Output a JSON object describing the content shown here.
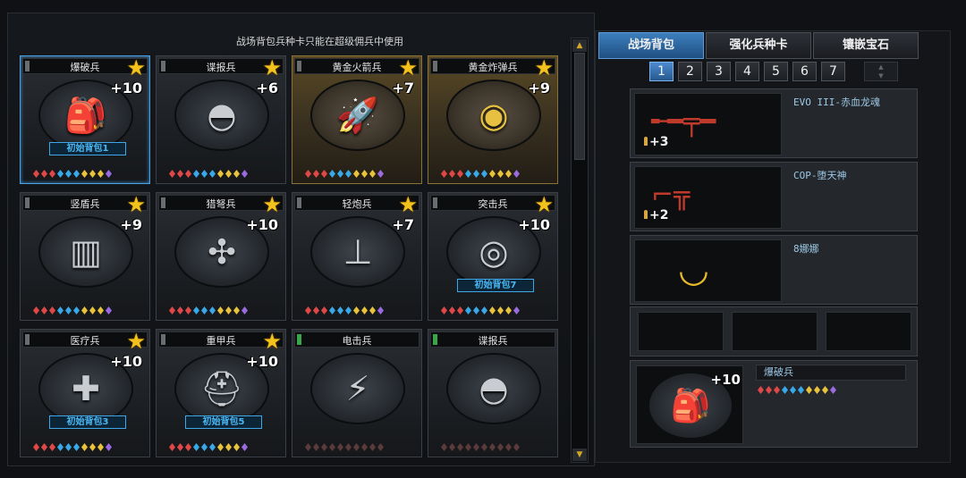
{
  "notice": "战场背包兵种卡只能在超级佣兵中使用",
  "cards": [
    {
      "title": "爆破兵",
      "level": "+10",
      "pack": "初始背包1",
      "icon": "demolition-pack-icon",
      "glyph": "🎒",
      "gold": false,
      "selected": true,
      "star": true,
      "tag": "gray"
    },
    {
      "title": "谍报兵",
      "level": "+6",
      "pack": "",
      "icon": "spy-mask-icon",
      "glyph": "◓",
      "gold": false,
      "selected": false,
      "star": true,
      "tag": "gray"
    },
    {
      "title": "黄金火箭兵",
      "level": "+7",
      "pack": "",
      "icon": "rocket-launcher-icon",
      "glyph": "🚀",
      "gold": true,
      "selected": false,
      "star": true,
      "tag": "gray"
    },
    {
      "title": "黄金炸弹兵",
      "level": "+9",
      "pack": "",
      "icon": "gold-bomb-icon",
      "glyph": "◉",
      "gold": true,
      "selected": false,
      "star": true,
      "tag": "gray"
    },
    {
      "title": "竖盾兵",
      "level": "+9",
      "pack": "",
      "icon": "tower-shield-icon",
      "glyph": "▥",
      "gold": false,
      "selected": false,
      "star": true,
      "tag": "gray"
    },
    {
      "title": "猎弩兵",
      "level": "+10",
      "pack": "",
      "icon": "crossbow-icon",
      "glyph": "✣",
      "gold": false,
      "selected": false,
      "star": true,
      "tag": "gray"
    },
    {
      "title": "轻炮兵",
      "level": "+7",
      "pack": "",
      "icon": "mortar-icon",
      "glyph": "⊥",
      "gold": false,
      "selected": false,
      "star": true,
      "tag": "gray"
    },
    {
      "title": "突击兵",
      "level": "+10",
      "pack": "初始背包7",
      "icon": "assault-scope-icon",
      "glyph": "◎",
      "gold": false,
      "selected": false,
      "star": true,
      "tag": "gray"
    },
    {
      "title": "医疗兵",
      "level": "+10",
      "pack": "初始背包3",
      "icon": "medkit-icon",
      "glyph": "✚",
      "gold": false,
      "selected": false,
      "star": true,
      "tag": "gray"
    },
    {
      "title": "重甲兵",
      "level": "+10",
      "pack": "初始背包5",
      "icon": "heavy-helmet-icon",
      "glyph": "⛑",
      "gold": false,
      "selected": false,
      "star": true,
      "tag": "gray"
    },
    {
      "title": "电击兵",
      "level": "",
      "pack": "",
      "icon": "electric-gauntlet-icon",
      "glyph": "⚡",
      "gold": false,
      "selected": false,
      "star": false,
      "tag": "green"
    },
    {
      "title": "谍报兵",
      "level": "",
      "pack": "",
      "icon": "spy-mask-icon",
      "glyph": "◓",
      "gold": false,
      "selected": false,
      "star": false,
      "tag": "green"
    }
  ],
  "tabs": [
    "战场背包",
    "强化兵种卡",
    "镶嵌宝石"
  ],
  "pages": [
    "1",
    "2",
    "3",
    "4",
    "5",
    "6",
    "7"
  ],
  "weapons": [
    {
      "name": "EVO III-赤血龙魂",
      "ammo": "+3",
      "icon": "assault-rifle-icon",
      "glyph": "╾━╤━",
      "banana": false
    },
    {
      "name": "COP-堕天神",
      "ammo": "+2",
      "icon": "pistol-icon",
      "glyph": "⌐╦",
      "banana": false
    },
    {
      "name": "8娜娜",
      "ammo": "",
      "icon": "banana-icon",
      "glyph": "◡",
      "banana": true
    }
  ],
  "selected": {
    "name": "爆破兵",
    "level": "+10",
    "icon": "demolition-pack-icon",
    "glyph": "🎒"
  },
  "gem_colors": [
    "#e04848",
    "#e04848",
    "#e04848",
    "#39a8e8",
    "#39a8e8",
    "#39a8e8",
    "#e8c23a",
    "#e8c23a",
    "#e8c23a",
    "#9a6ae0"
  ],
  "colors": {
    "accent": "#3d7fbd",
    "gold": "#f3c21c",
    "pack_blue": "#49b7f5"
  }
}
